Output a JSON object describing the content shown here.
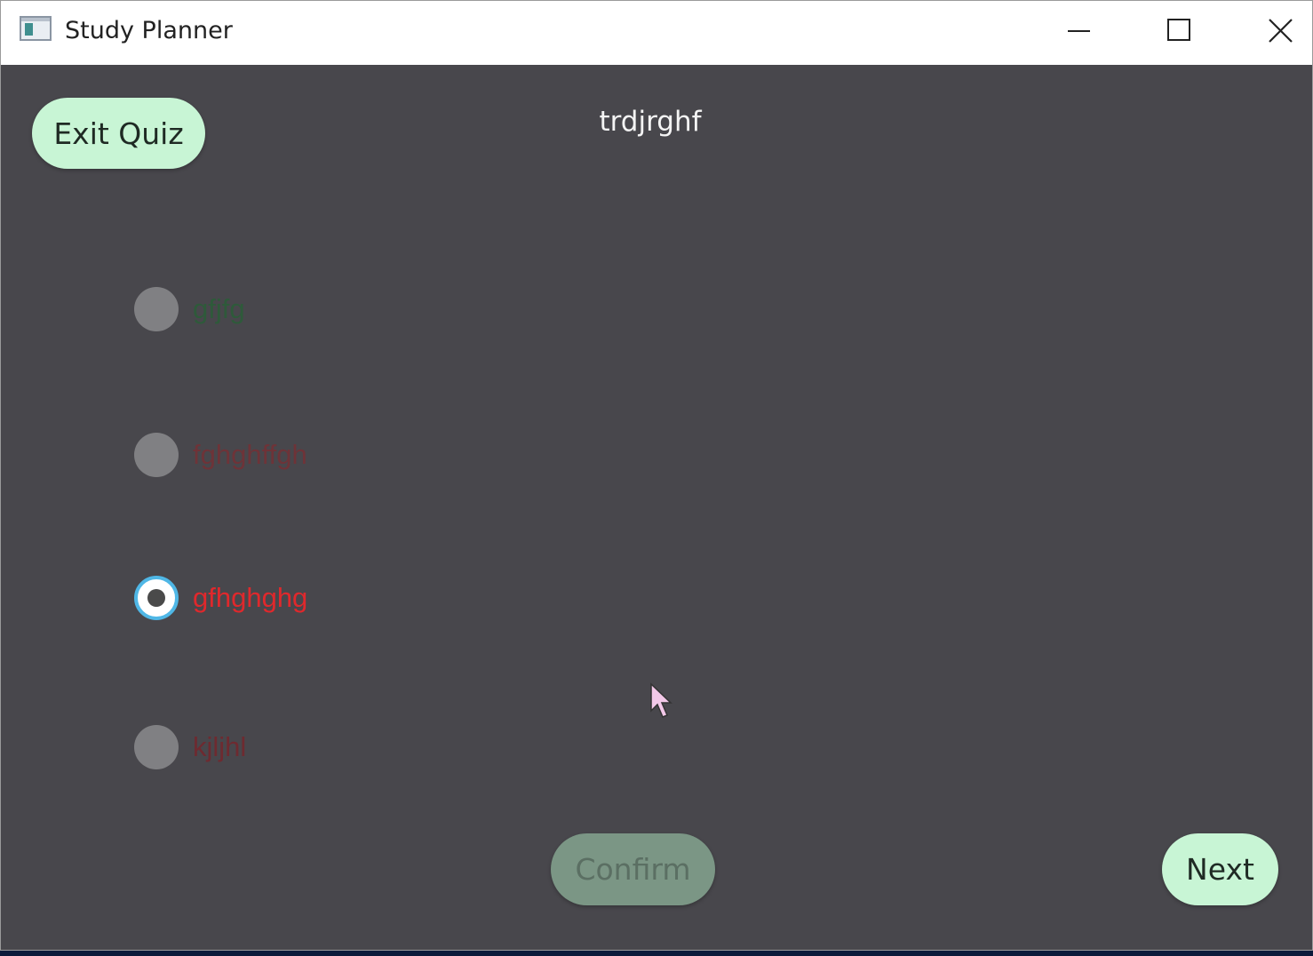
{
  "window": {
    "title": "Study Planner",
    "controls": {
      "minimize": "minimize-icon",
      "maximize": "maximize-icon",
      "close": "close-icon"
    }
  },
  "toolbar": {
    "exit_label": "Exit Quiz"
  },
  "quiz": {
    "question": "trdjrghf",
    "options": [
      {
        "label": "gfjfg",
        "color": "#2e5a3a",
        "selected": false
      },
      {
        "label": "fghghffgh",
        "color": "#6e3338",
        "selected": false
      },
      {
        "label": "gfhghghg",
        "color": "#e0282c",
        "selected": true
      },
      {
        "label": "kjljhl",
        "color": "#6e2a30",
        "selected": false
      }
    ]
  },
  "actions": {
    "confirm_label": "Confirm",
    "next_label": "Next"
  },
  "colors": {
    "background": "#48474c",
    "button_accent": "#c8f5d5",
    "button_disabled": "#7b9685",
    "radio_selected_ring": "#4fb7e6"
  }
}
